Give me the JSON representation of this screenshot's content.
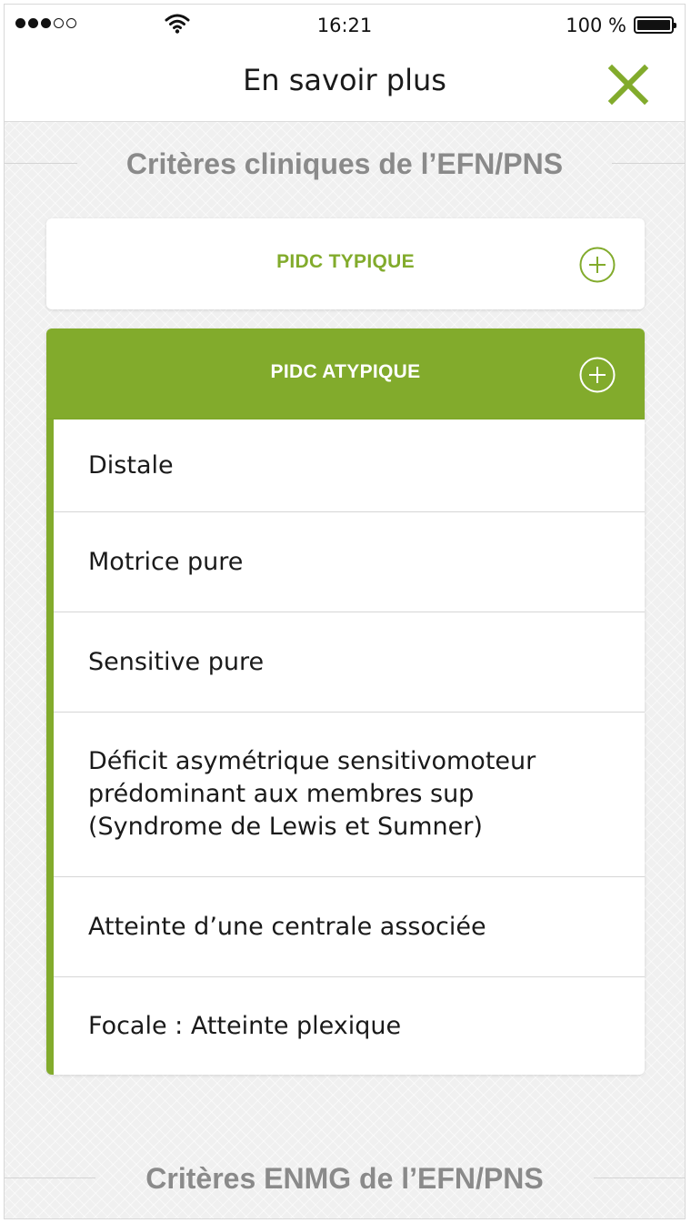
{
  "status_bar": {
    "time": "16:21",
    "battery": "100 %",
    "signal_strength": 3,
    "signal_max": 5
  },
  "header": {
    "title": "En savoir plus",
    "close_icon": "close-x-icon"
  },
  "sections": {
    "clinical_title": "Critères cliniques de l’EFN/PNS",
    "enmg_title": "Critères ENMG de l’EFN/PNS"
  },
  "accordion": {
    "typique": {
      "label": "PIDC TYPIQUE",
      "icon": "plus-circle-icon",
      "expanded": false
    },
    "atypique": {
      "label": "PIDC ATYPIQUE",
      "icon": "plus-circle-icon",
      "expanded": true
    },
    "atypique_items": [
      "Distale",
      "Motrice pure",
      "Sensitive pure",
      "Déficit asymétrique sensitivomoteur prédominant aux membres sup (Syndrome de Lewis et Sumner)",
      "Atteinte d’une centrale associée",
      "Focale : Atteinte plexique"
    ]
  },
  "colors": {
    "accent": "#82ab2c",
    "section_header_text": "#8a8a8a",
    "background": "#f0f0f0",
    "text": "#1a1a1a"
  }
}
